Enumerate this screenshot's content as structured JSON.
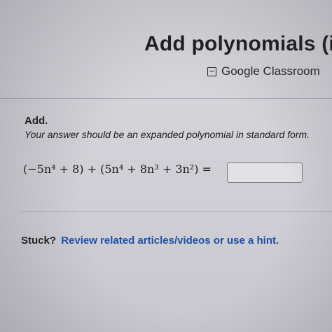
{
  "header": {
    "title": "Add polynomials (in",
    "classroom_label": "Google Classroom",
    "classroom_icon": "classroom-box-icon"
  },
  "problem": {
    "heading": "Add.",
    "instructions": "Your answer should be an expanded polynomial in standard form.",
    "expression": "(−5n⁴ + 8) + (5n⁴ + 8n³ + 3n²) =",
    "answer_value": ""
  },
  "footer": {
    "stuck_label": "Stuck?",
    "hint_link": "Review related articles/videos or use a hint."
  },
  "colors": {
    "link": "#1f4fa8",
    "text": "#1d1d22",
    "background": "#d3d2d8"
  }
}
